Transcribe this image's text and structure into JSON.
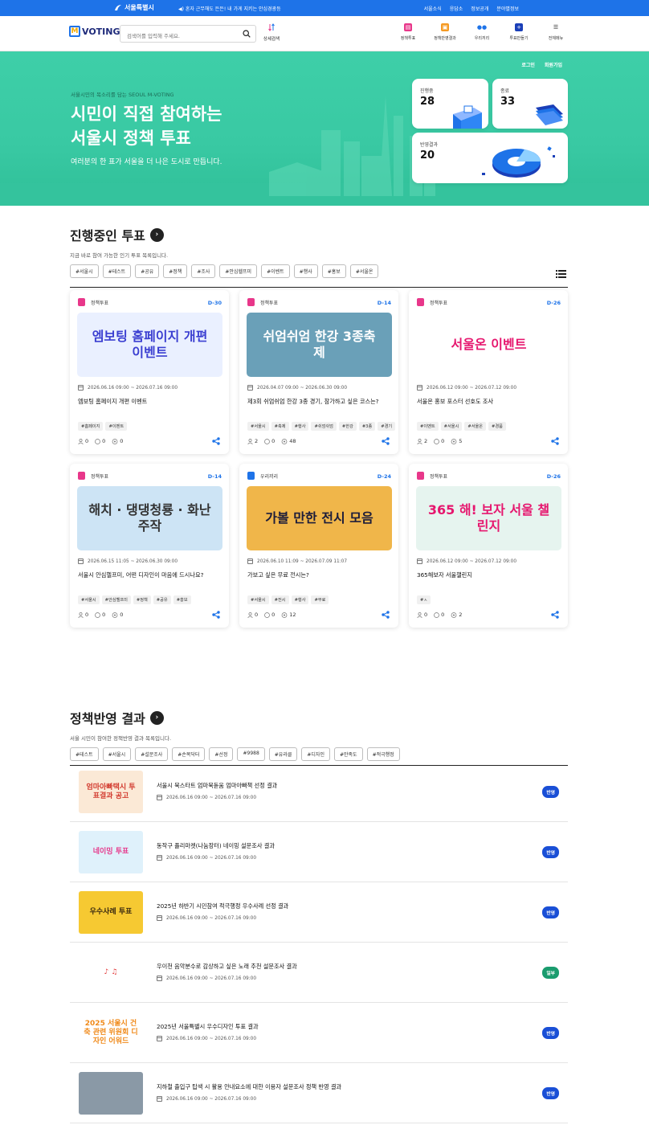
{
  "topbar": {
    "logo": "서울특별시",
    "notice": "◀) 혼자 근무해도 든든! 내 가게 지키는 안심경광등",
    "links": [
      "서울소식",
      "응답소",
      "정보공개",
      "분야별정보"
    ]
  },
  "header": {
    "brand": "VOTING",
    "search_placeholder": "검색어를 입력해 주세요.",
    "detail_label": "상세검색",
    "nav": [
      {
        "label": "정책투표",
        "icon": "policy-vote-icon",
        "color": "#e8378a"
      },
      {
        "label": "정책반영결과",
        "icon": "policy-result-icon",
        "color": "#f59a23"
      },
      {
        "label": "우리끼리",
        "icon": "people-icon",
        "color": "#1e73e8"
      },
      {
        "label": "투표만들기",
        "icon": "plus-icon",
        "color": "#1a3fb8"
      },
      {
        "label": "전체메뉴",
        "icon": "menu-icon",
        "color": "#333333"
      }
    ]
  },
  "hero": {
    "auth": [
      "로그인",
      "회원가입"
    ],
    "subtitle": "서울시민의 목소리를 담는 SEOUL M-VOTING",
    "title_line1": "시민이 직접 참여하는",
    "title_line2": "서울시 정책 투표",
    "description": "여러분의 한 표가 서울을 더 나은 도시로 만듭니다.",
    "stats": [
      {
        "label": "진행중",
        "value": "28"
      },
      {
        "label": "종료",
        "value": "33"
      },
      {
        "label": "반영결과",
        "value": "20"
      }
    ]
  },
  "ongoing": {
    "title": "진행중인 투표",
    "description": "지금 바로 참여 가능한 인기 투표 목록입니다.",
    "tags": [
      "#서울시",
      "#테스트",
      "#공유",
      "#정책",
      "#조사",
      "#안심헬프미",
      "#이벤트",
      "#행사",
      "#홍보",
      "#서울온"
    ],
    "cards": [
      {
        "category": "정책투표",
        "cat_color": "#e8378a",
        "dday": "D-30",
        "thumb_text": "엠보팅 홈페이지 개편 이벤트",
        "thumb_bg": "#eaf0ff",
        "thumb_fg": "#3b3fd1",
        "period": "2026.06.16 09:00 ~ 2026.07.16 09:00",
        "title": "엠보팅 홈페이지 개편 이벤트",
        "tags": [
          "#홈페이지",
          "#이벤트"
        ],
        "people": "0",
        "comments": "0",
        "views": "0"
      },
      {
        "category": "정책투표",
        "cat_color": "#e8378a",
        "dday": "D-14",
        "thumb_text": "쉬엄쉬엄 한강 3종축제",
        "thumb_bg": "#6aa0b8",
        "thumb_fg": "#ffffff",
        "period": "2026.04.07 09:00 ~ 2026.06.30 09:00",
        "title": "제3회 쉬엄쉬엄 한강 3종 경기, 참가하고 싶은 코스는?",
        "tags": [
          "#서울시",
          "#축제",
          "#행사",
          "#쉬엄쉬엄",
          "#한강",
          "#3종",
          "#경기"
        ],
        "people": "2",
        "comments": "0",
        "views": "48"
      },
      {
        "category": "정책투표",
        "cat_color": "#e8378a",
        "dday": "D-26",
        "thumb_text": "서울온 이벤트",
        "thumb_bg": "#ffffff",
        "thumb_fg": "#e6166e",
        "period": "2026.06.12 09:00 ~ 2026.07.12 09:00",
        "title": "서울온 홍보 포스터 선호도 조사",
        "tags": [
          "#이벤트",
          "#서울시",
          "#서울온",
          "#경품"
        ],
        "people": "2",
        "comments": "0",
        "views": "5"
      },
      {
        "category": "정책투표",
        "cat_color": "#e8378a",
        "dday": "D-14",
        "thumb_text": "해치 · 댕댕청룡 · 화난주작",
        "thumb_bg": "#cde4f5",
        "thumb_fg": "#333333",
        "period": "2026.06.15 11:05 ~ 2026.06.30 09:00",
        "title": "서울시 안심헬프미, 어떤 디자인이 마음에 드시나요?",
        "tags": [
          "#서울시",
          "#안심헬프미",
          "#정책",
          "#공유",
          "#홍보"
        ],
        "people": "0",
        "comments": "0",
        "views": "0"
      },
      {
        "category": "우리끼리",
        "cat_color": "#1e73e8",
        "dday": "D-24",
        "thumb_text": "가볼 만한 전시 모음",
        "thumb_bg": "#f0b64a",
        "thumb_fg": "#1c1c3a",
        "period": "2026.06.10 11:09 ~ 2026.07.09 11:07",
        "title": "가보고 싶은 무료 전시는?",
        "tags": [
          "#서울시",
          "#전시",
          "#행사",
          "#무료"
        ],
        "people": "0",
        "comments": "0",
        "views": "12"
      },
      {
        "category": "정책투표",
        "cat_color": "#e8378a",
        "dday": "D-26",
        "thumb_text": "365 해! 보자 서울 챌린지",
        "thumb_bg": "#e6f4ef",
        "thumb_fg": "#e6166e",
        "period": "2026.06.12 09:00 ~ 2026.07.12 09:00",
        "title": "365해보자 서울챌린지",
        "tags": [
          "#ㅅ"
        ],
        "people": "0",
        "comments": "0",
        "views": "2"
      }
    ]
  },
  "results": {
    "title": "정책반영 결과",
    "description": "서울 시민이 참여한 정책반영 결과 목록입니다.",
    "tags": [
      "#테스트",
      "#서울시",
      "#설문조사",
      "#손목닥터",
      "#선정",
      "#9988",
      "#유라클",
      "#디자인",
      "#만족도",
      "#적극행정"
    ],
    "rows": [
      {
        "thumb_text": "엄마아빠택시 투표결과 공고",
        "thumb_bg": "#fbe9d6",
        "thumb_fg": "#d23a2e",
        "title": "서울시 북스타트 엄마북돋움 엄마아빠책 선정 결과",
        "period": "2026.06.16 09:00 ~ 2026.07.16 09:00",
        "badge": "반영",
        "badge_color": "#1a4fd6"
      },
      {
        "thumb_text": "네이밍 투표",
        "thumb_bg": "#dff1fb",
        "thumb_fg": "#e63a8c",
        "title": "동작구 플리마켓(나눔장터) 네이밍 설문조사 결과",
        "period": "2026.06.16 09:00 ~ 2026.07.16 09:00",
        "badge": "반영",
        "badge_color": "#1a4fd6"
      },
      {
        "thumb_text": "우수사례 투표",
        "thumb_bg": "#f6c932",
        "thumb_fg": "#3a2a10",
        "title": "2025년 하반기 시민참여 적극행정 우수사례 선정 결과",
        "period": "2026.06.16 09:00 ~ 2026.07.16 09:00",
        "badge": "반영",
        "badge_color": "#1a4fd6"
      },
      {
        "thumb_text": "♪ ♫",
        "thumb_bg": "#ffffff",
        "thumb_fg": "#e23a3a",
        "title": "우이천 음악분수로 감상하고 싶은 노래 추천 설문조사 결과",
        "period": "2026.06.16 09:00 ~ 2026.07.16 09:00",
        "badge": "일부",
        "badge_color": "#1a9c6e"
      },
      {
        "thumb_text": "2025 서울시 건축 관련 위원회 디자인 어워드",
        "thumb_bg": "#ffffff",
        "thumb_fg": "#f08a1a",
        "title": "2025년 서울특별시 우수디자인 투표 결과",
        "period": "2026.06.16 09:00 ~ 2026.07.16 09:00",
        "badge": "반영",
        "badge_color": "#1a4fd6"
      },
      {
        "thumb_text": "",
        "thumb_bg": "#8a99a6",
        "thumb_fg": "#ffffff",
        "title": "지하철 출입구 탑색 시 활용 안내요소에 대한 이용자 설문조사 정책 반영 결과",
        "period": "2026.06.16 09:00 ~ 2026.07.16 09:00",
        "badge": "반영",
        "badge_color": "#1a4fd6"
      }
    ]
  }
}
